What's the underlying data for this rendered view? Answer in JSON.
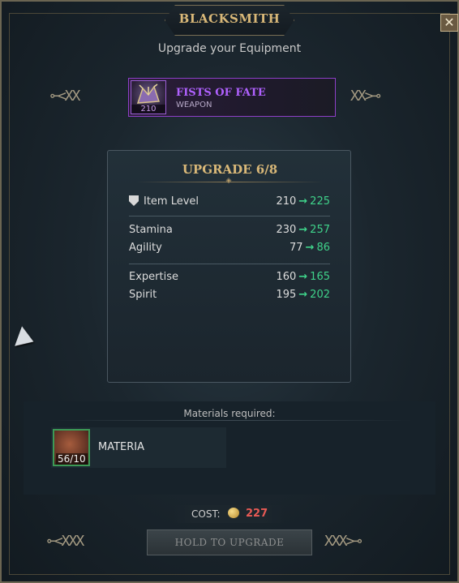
{
  "window": {
    "title": "BLACKSMITH",
    "subtitle": "Upgrade your Equipment",
    "close_label": "✕"
  },
  "item": {
    "name": "FISTS OF FATE",
    "type": "WEAPON",
    "item_level": "210",
    "rarity_color": "#b061ff"
  },
  "upgrade": {
    "title": "UPGRADE 6/8",
    "item_level": {
      "label": "Item Level",
      "from": "210",
      "to": "225"
    },
    "group1": [
      {
        "label": "Stamina",
        "from": "230",
        "to": "257"
      },
      {
        "label": "Agility",
        "from": "77",
        "to": "86"
      }
    ],
    "group2": [
      {
        "label": "Expertise",
        "from": "160",
        "to": "165"
      },
      {
        "label": "Spirit",
        "from": "195",
        "to": "202"
      }
    ]
  },
  "materials": {
    "header": "Materials required:",
    "items": [
      {
        "name": "MATERIA",
        "count": "56/10"
      }
    ]
  },
  "cost": {
    "label": "COST:",
    "value": "227",
    "value_color": "#e85a55"
  },
  "action": {
    "button_label": "HOLD TO UPGRADE"
  },
  "colors": {
    "accent_gold": "#d9b878",
    "stat_increase": "#3fd28a"
  },
  "icons": {
    "close": "close-icon",
    "weapon": "fist-weapon-icon",
    "item_level": "shield-icon",
    "material": "materia-icon",
    "currency": "coin-icon",
    "cursor": "cursor-pointer-icon"
  }
}
